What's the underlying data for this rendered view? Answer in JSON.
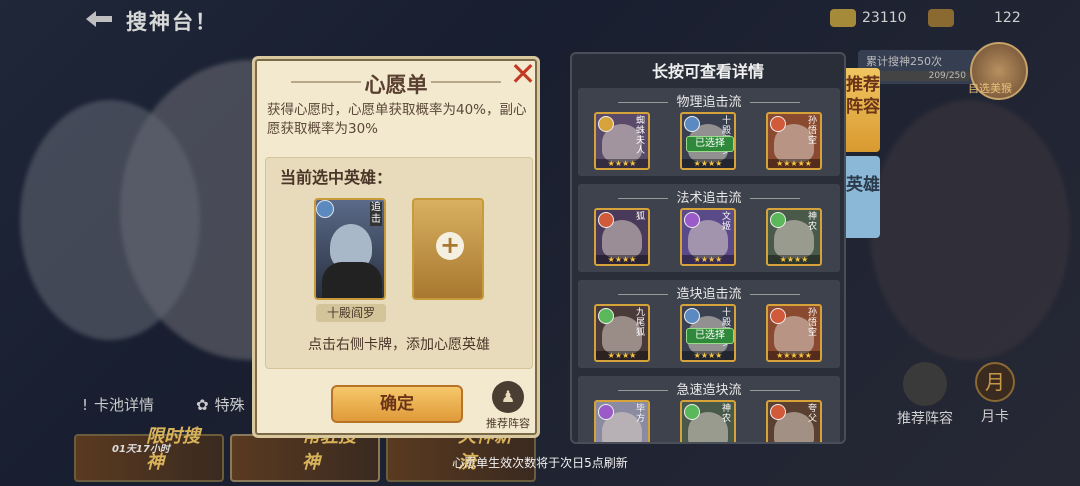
{
  "header": {
    "title": "搜神台！",
    "currency1": "23110",
    "currency2": "122"
  },
  "background": {
    "tab_pool_details": "卡池详情",
    "tab_special": "特殊",
    "banner_limited": "限时搜神",
    "banner_limited_timer": "01天17小时",
    "banner_permanent": "常驻搜神",
    "banner_third": "天神新流",
    "cumulative_label": "累计搜神250次",
    "cumulative_progress": "209/250",
    "select_beauty": "自选美猴",
    "recommend_lineup": "推荐阵容",
    "monthly_card": "月卡",
    "monthly_icon": "月"
  },
  "wish": {
    "title": "心愿单",
    "close": "✕",
    "description": "获得心愿时，心愿单获取概率为40%，副心愿获取概率为30%",
    "current_label": "当前选中英雄：",
    "selected_hero_name": "十殿阎罗",
    "selected_hero_tag": "追击",
    "add_symbol": "+",
    "hint": "点击右侧卡牌，添加心愿英雄",
    "confirm": "确定",
    "lineup_button": "推荐阵容"
  },
  "lineup": {
    "header": "长按可查看详情",
    "groups": [
      {
        "title": "物理追击流",
        "heroes": [
          {
            "name": "蜘蛛夫人",
            "cls_color": "#d6a23a",
            "bg": "#5a4a6a",
            "tag": "",
            "stars": "★★★★"
          },
          {
            "name": "十殿阎罗",
            "cls_color": "#5a8ac0",
            "bg": "#3a4050",
            "tag": "已选择",
            "stars": "★★★★"
          },
          {
            "name": "孙悟空",
            "cls_color": "#d05a3a",
            "bg": "#8a4a30",
            "tag": "",
            "stars": "★★★★★"
          }
        ]
      },
      {
        "title": "法术追击流",
        "heroes": [
          {
            "name": "狐",
            "cls_color": "#d05a3a",
            "bg": "#4a3a5a",
            "tag": "",
            "stars": "★★★★"
          },
          {
            "name": "文姬",
            "cls_color": "#9a5ac8",
            "bg": "#5a4a8a",
            "tag": "",
            "stars": "★★★★"
          },
          {
            "name": "神农",
            "cls_color": "#5ab85a",
            "bg": "#4a5a4a",
            "tag": "",
            "stars": "★★★★"
          }
        ]
      },
      {
        "title": "造块追击流",
        "heroes": [
          {
            "name": "九尾狐",
            "cls_color": "#5ab85a",
            "bg": "#4a3a3a",
            "tag": "",
            "stars": "★★★★"
          },
          {
            "name": "十殿阎罗",
            "cls_color": "#5a8ac0",
            "bg": "#3a4050",
            "tag": "已选择",
            "stars": "★★★★"
          },
          {
            "name": "孙悟空",
            "cls_color": "#d05a3a",
            "bg": "#8a4a30",
            "tag": "",
            "stars": "★★★★★"
          }
        ]
      },
      {
        "title": "急速造块流",
        "heroes": [
          {
            "name": "毕方",
            "cls_color": "#9a5ac8",
            "bg": "#8a8aa0",
            "tag": "",
            "stars": ""
          },
          {
            "name": "神农",
            "cls_color": "#5ab85a",
            "bg": "#4a5a4a",
            "tag": "",
            "stars": ""
          },
          {
            "name": "夸父",
            "cls_color": "#d05a3a",
            "bg": "#5a4030",
            "tag": "",
            "stars": ""
          }
        ]
      }
    ],
    "tab_recommend": "推荐阵容",
    "tab_hero": "英雄"
  },
  "footer": {
    "message": "心愿单生效次数将于次日5点刷新"
  }
}
